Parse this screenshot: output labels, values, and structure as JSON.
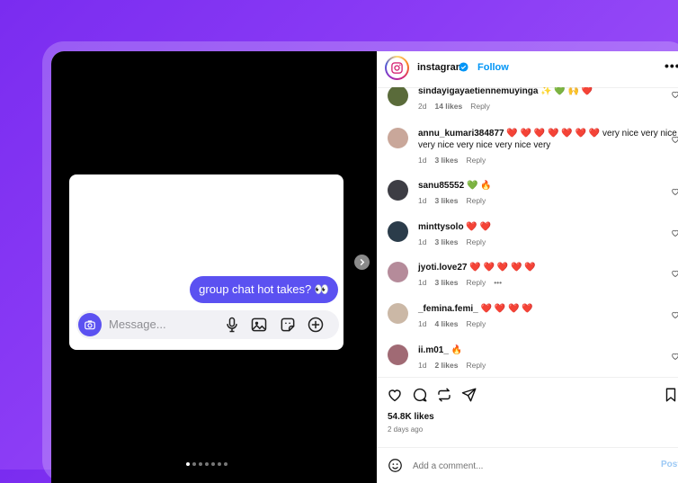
{
  "media": {
    "bubble_text": "group chat hot takes? 👀",
    "message_placeholder": "Message...",
    "icons": [
      "camera-icon",
      "microphone-icon",
      "image-icon",
      "sticker-icon",
      "plus-circle-icon"
    ],
    "carousel_dots": 7,
    "active_dot": 0
  },
  "header": {
    "username": "instagram",
    "follow_label": "Follow",
    "more_label": "•••"
  },
  "comments": [
    {
      "user": "sindayigayaetiennemuyinga",
      "text": "✨ 💚 🙌 ❤️",
      "time": "2d",
      "likes": "14 likes",
      "reply": "Reply",
      "avatar_color": "#5a6b3a"
    },
    {
      "user": "annu_kumari384877",
      "text": "❤️ ❤️ ❤️ ❤️ ❤️ ❤️ ❤️ very nice very nice very nice very nice very nice very",
      "time": "1d",
      "likes": "3 likes",
      "reply": "Reply",
      "avatar_color": "#c9a79a"
    },
    {
      "user": "sanu85552",
      "text": "💚 🔥",
      "time": "1d",
      "likes": "3 likes",
      "reply": "Reply",
      "avatar_color": "#3d3d44"
    },
    {
      "user": "minttysolo",
      "text": "❤️ ❤️",
      "time": "1d",
      "likes": "3 likes",
      "reply": "Reply",
      "avatar_color": "#2b3c4a"
    },
    {
      "user": "jyoti.love27",
      "text": "❤️ ❤️ ❤️ ❤️ ❤️",
      "time": "1d",
      "likes": "3 likes",
      "reply": "Reply",
      "more": "•••",
      "avatar_color": "#b58b9a"
    },
    {
      "user": "_femina.femi_",
      "text": "❤️ ❤️ ❤️ ❤️",
      "time": "1d",
      "likes": "4 likes",
      "reply": "Reply",
      "avatar_color": "#cbb8a6"
    },
    {
      "user": "ii.m01_",
      "text": "🔥",
      "time": "1d",
      "likes": "2 likes",
      "reply": "Reply",
      "avatar_color": "#a06a74"
    }
  ],
  "actions": {
    "icons": [
      "heart-icon",
      "comment-icon",
      "repost-icon",
      "share-icon",
      "bookmark-icon"
    ],
    "likes": "54.8K likes",
    "time_ago": "2 days ago"
  },
  "add_comment": {
    "placeholder": "Add a comment...",
    "post_label": "Post"
  },
  "colors": {
    "accent": "#5b51f1",
    "link_blue": "#0095f6",
    "background_purple": "#7a2cf0"
  }
}
